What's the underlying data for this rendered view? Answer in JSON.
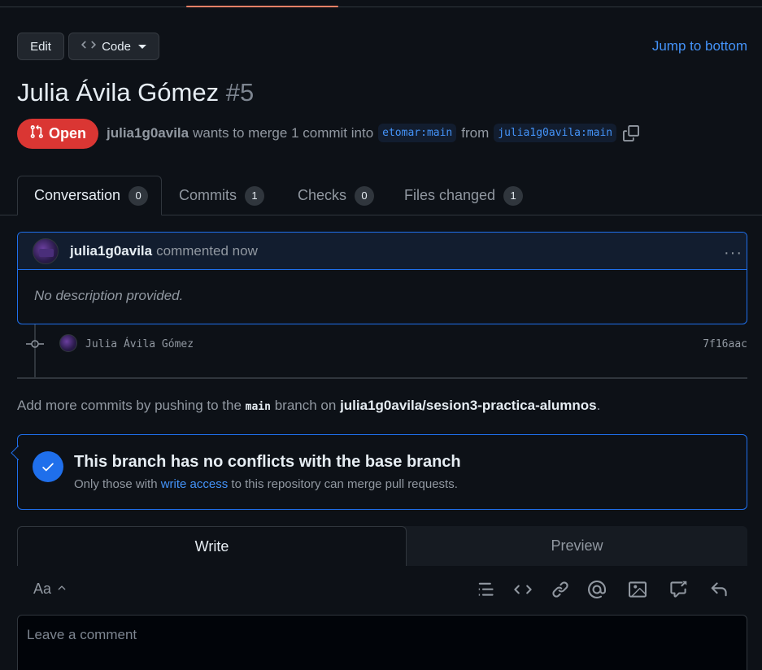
{
  "header": {
    "edit_label": "Edit",
    "code_label": "Code",
    "jump_label": "Jump to bottom"
  },
  "pr": {
    "title": "Julia Ávila Gómez",
    "number": "#5",
    "state": "Open",
    "author": "julia1g0avila",
    "merge_text": "wants to merge 1 commit into",
    "base_ref": "etomar:main",
    "from_text": "from",
    "head_ref": "julia1g0avila:main"
  },
  "tabs": [
    {
      "label": "Conversation",
      "count": "0"
    },
    {
      "label": "Commits",
      "count": "1"
    },
    {
      "label": "Checks",
      "count": "0"
    },
    {
      "label": "Files changed",
      "count": "1"
    }
  ],
  "comment": {
    "author": "julia1g0avila",
    "action": "commented now",
    "body": "No description provided.",
    "menu": "···"
  },
  "commit": {
    "author": "Julia Ávila Gómez",
    "sha": "7f16aac"
  },
  "hint": {
    "prefix": "Add more commits by pushing to the",
    "branch": "main",
    "middle": "branch on",
    "repo": "julia1g0avila/sesion3-practica-alumnos",
    "suffix": "."
  },
  "merge": {
    "title": "This branch has no conflicts with the base branch",
    "sub_prefix": "Only those with",
    "sub_link": "write access",
    "sub_suffix": "to this repository can merge pull requests."
  },
  "editor": {
    "write_tab": "Write",
    "preview_tab": "Preview",
    "aa": "Aa",
    "placeholder": "Leave a comment"
  },
  "colors": {
    "accent": "#1f6feb",
    "open_state": "#da3633",
    "link": "#4493f8",
    "background": "#0d1117"
  }
}
